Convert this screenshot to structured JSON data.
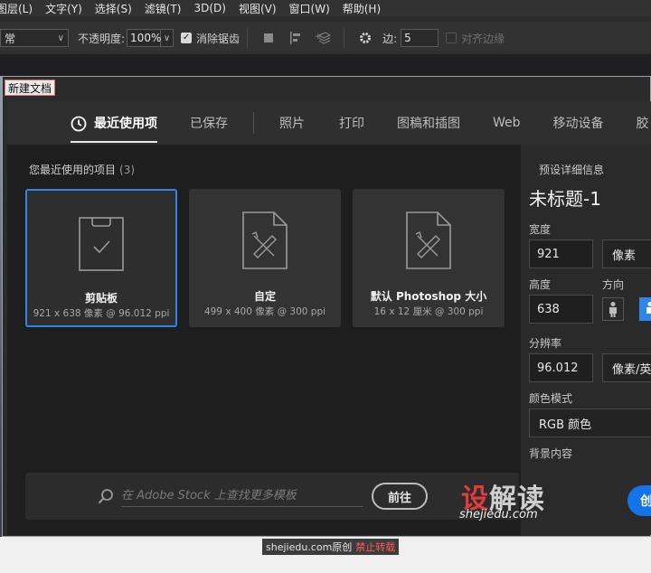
{
  "menubar": {
    "items": [
      "图层(L)",
      "文字(Y)",
      "选择(S)",
      "滤镜(T)",
      "3D(D)",
      "视图(V)",
      "窗口(W)",
      "帮助(H)"
    ]
  },
  "optionsbar": {
    "mode_value": "常",
    "opacity_label": "不透明度:",
    "opacity_value": "100%",
    "antialias_label": "消除锯齿",
    "border_label": "边:",
    "border_value": "5",
    "align_edges_label": "对齐边缘",
    "icons": [
      "square-icon",
      "align-left-icon",
      "arrange-stack-icon",
      "gear-icon"
    ]
  },
  "dialog": {
    "title": "新建文档",
    "tabs": [
      {
        "label": "最近使用项",
        "active": true
      },
      {
        "label": "已保存"
      },
      {
        "label": "照片"
      },
      {
        "label": "打印"
      },
      {
        "label": "图稿和插图"
      },
      {
        "label": "Web"
      },
      {
        "label": "移动设备"
      },
      {
        "label": "胶"
      }
    ],
    "recent": {
      "heading": "您最近使用的项目",
      "count": "(3)",
      "items": [
        {
          "name": "剪贴板",
          "meta": "921 x 638 像素 @ 96.012 ppi",
          "icon": "clipboard-icon",
          "selected": true
        },
        {
          "name": "自定",
          "meta": "499 x 400 像素 @ 300 ppi",
          "icon": "document-ruler-icon"
        },
        {
          "name": "默认 Photoshop 大小",
          "meta": "16 x 12 厘米 @ 300 ppi",
          "icon": "document-ruler-icon"
        }
      ]
    },
    "stock": {
      "placeholder": "在 Adobe Stock 上查找更多模板",
      "go_label": "前往"
    },
    "details": {
      "heading": "预设详细信息",
      "doc_name": "未标题-1",
      "width_label": "宽度",
      "width_value": "921",
      "width_unit": "像素",
      "height_label": "高度",
      "height_value": "638",
      "orientation_label": "方向",
      "resolution_label": "分辨率",
      "resolution_value": "96.012",
      "resolution_unit": "像素/英",
      "color_mode_label": "颜色模式",
      "color_mode_value": "RGB 颜色",
      "background_label": "背景内容",
      "create_label": "创"
    }
  },
  "watermark": {
    "logo_part1": "设",
    "logo_part2": "解读",
    "domain": "shejiedu.com"
  },
  "footer": {
    "note": "shejiedu.com原创",
    "warning": "禁止转载"
  },
  "colors": {
    "accent": "#2f86e8",
    "create_button": "#1473e6",
    "watermark_red": "#e23b3b"
  }
}
